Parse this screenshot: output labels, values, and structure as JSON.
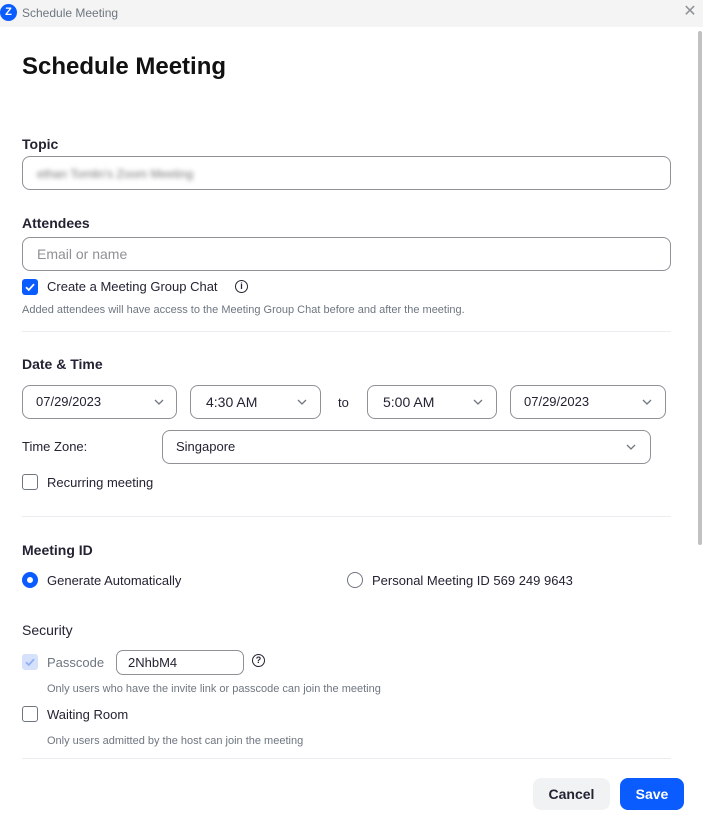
{
  "window": {
    "app_logo": "Z",
    "title": "Schedule Meeting",
    "close": "✕"
  },
  "heading": "Schedule Meeting",
  "topic": {
    "label": "Topic",
    "value": "ethan Tomlin's Zoom Meeting"
  },
  "attendees": {
    "label": "Attendees",
    "placeholder": "Email or name",
    "group_chat_label": "Create a Meeting Group Chat",
    "group_chat_checked": true,
    "group_chat_hint": "Added attendees will have access to the Meeting Group Chat before and after the meeting."
  },
  "datetime": {
    "label": "Date & Time",
    "start_date": "07/29/2023",
    "start_time": "4:30 AM",
    "to": "to",
    "end_time": "5:00 AM",
    "end_date": "07/29/2023",
    "timezone_label": "Time Zone:",
    "timezone": "Singapore",
    "recurring_label": "Recurring meeting",
    "recurring_checked": false
  },
  "meeting_id": {
    "label": "Meeting ID",
    "option_auto": "Generate Automatically",
    "option_personal": "Personal Meeting ID 569 249 9643",
    "selected": "auto"
  },
  "security": {
    "label": "Security",
    "passcode_label": "Passcode",
    "passcode_value": "2NhbM4",
    "passcode_hint": "Only users who have the invite link or passcode can join the meeting",
    "waiting_room_label": "Waiting Room",
    "waiting_room_hint": "Only users admitted by the host can join the meeting"
  },
  "footer": {
    "cancel": "Cancel",
    "save": "Save"
  },
  "colors": {
    "accent": "#0b5cff",
    "border": "#909096",
    "text": "#232333"
  }
}
